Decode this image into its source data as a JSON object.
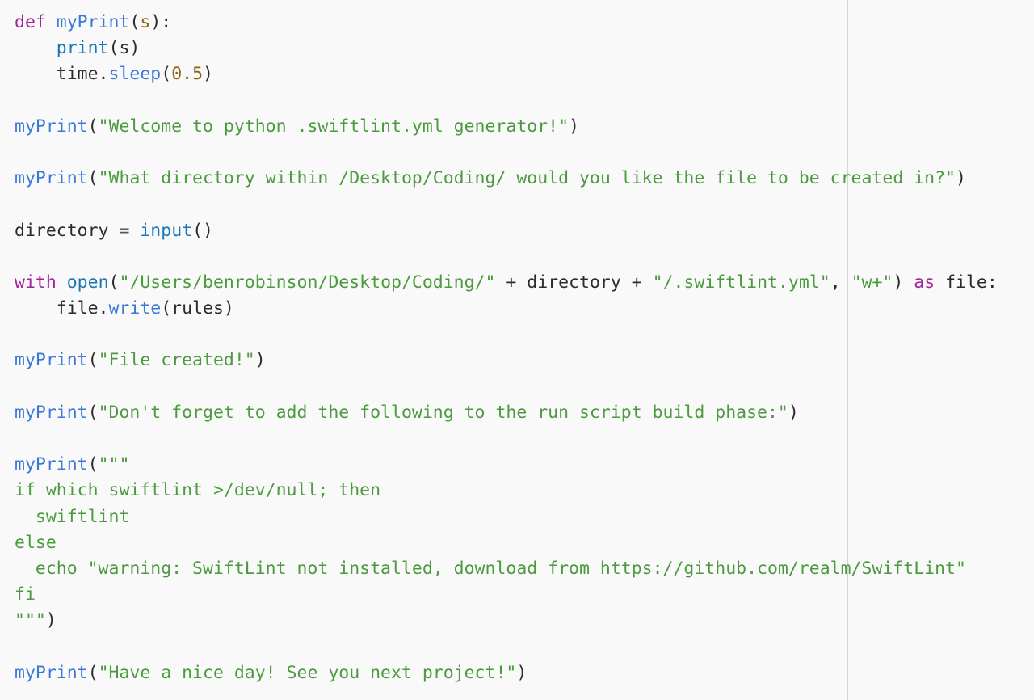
{
  "colors": {
    "background": "#f9f9f9",
    "keyword": "#a3239d",
    "function": "#3c78d8",
    "builtin": "#1a76b8",
    "string": "#4c9a3f",
    "number": "#8b6508",
    "text": "#2b2b2b"
  },
  "code": {
    "lines": [
      [
        {
          "t": "kw",
          "v": "def"
        },
        {
          "t": "txt",
          "v": " "
        },
        {
          "t": "fn",
          "v": "myPrint"
        },
        {
          "t": "txt",
          "v": "("
        },
        {
          "t": "prm",
          "v": "s"
        },
        {
          "t": "txt",
          "v": "):"
        }
      ],
      [
        {
          "t": "txt",
          "v": "    "
        },
        {
          "t": "bi",
          "v": "print"
        },
        {
          "t": "txt",
          "v": "(s)"
        }
      ],
      [
        {
          "t": "txt",
          "v": "    time."
        },
        {
          "t": "fn",
          "v": "sleep"
        },
        {
          "t": "txt",
          "v": "("
        },
        {
          "t": "num",
          "v": "0.5"
        },
        {
          "t": "txt",
          "v": ")"
        }
      ],
      [],
      [
        {
          "t": "fn",
          "v": "myPrint"
        },
        {
          "t": "txt",
          "v": "("
        },
        {
          "t": "str",
          "v": "\"Welcome to python .swiftlint.yml generator!\""
        },
        {
          "t": "txt",
          "v": ")"
        }
      ],
      [],
      [
        {
          "t": "fn",
          "v": "myPrint"
        },
        {
          "t": "txt",
          "v": "("
        },
        {
          "t": "str",
          "v": "\"What directory within /Desktop/Coding/ would you like the file to be created in?\""
        },
        {
          "t": "txt",
          "v": ")"
        }
      ],
      [],
      [
        {
          "t": "txt",
          "v": "directory "
        },
        {
          "t": "op",
          "v": "="
        },
        {
          "t": "txt",
          "v": " "
        },
        {
          "t": "bi",
          "v": "input"
        },
        {
          "t": "txt",
          "v": "()"
        }
      ],
      [],
      [
        {
          "t": "kw",
          "v": "with"
        },
        {
          "t": "txt",
          "v": " "
        },
        {
          "t": "bi",
          "v": "open"
        },
        {
          "t": "txt",
          "v": "("
        },
        {
          "t": "str",
          "v": "\"/Users/benrobinson/Desktop/Coding/\""
        },
        {
          "t": "txt",
          "v": " + directory + "
        },
        {
          "t": "str",
          "v": "\"/.swiftlint.yml\""
        },
        {
          "t": "txt",
          "v": ", "
        },
        {
          "t": "str",
          "v": "\"w+\""
        },
        {
          "t": "txt",
          "v": ") "
        },
        {
          "t": "kw",
          "v": "as"
        },
        {
          "t": "txt",
          "v": " file:"
        }
      ],
      [
        {
          "t": "txt",
          "v": "    file."
        },
        {
          "t": "fn",
          "v": "write"
        },
        {
          "t": "txt",
          "v": "(rules)"
        }
      ],
      [],
      [
        {
          "t": "fn",
          "v": "myPrint"
        },
        {
          "t": "txt",
          "v": "("
        },
        {
          "t": "str",
          "v": "\"File created!\""
        },
        {
          "t": "txt",
          "v": ")"
        }
      ],
      [],
      [
        {
          "t": "fn",
          "v": "myPrint"
        },
        {
          "t": "txt",
          "v": "("
        },
        {
          "t": "str",
          "v": "\"Don't forget to add the following to the run script build phase:\""
        },
        {
          "t": "txt",
          "v": ")"
        }
      ],
      [],
      [
        {
          "t": "fn",
          "v": "myPrint"
        },
        {
          "t": "txt",
          "v": "("
        },
        {
          "t": "str",
          "v": "\"\"\""
        }
      ],
      [
        {
          "t": "str",
          "v": "if which swiftlint >/dev/null; then"
        }
      ],
      [
        {
          "t": "str",
          "v": "  swiftlint"
        }
      ],
      [
        {
          "t": "str",
          "v": "else"
        }
      ],
      [
        {
          "t": "str",
          "v": "  echo \"warning: SwiftLint not installed, download from https://github.com/realm/SwiftLint\""
        }
      ],
      [
        {
          "t": "str",
          "v": "fi"
        }
      ],
      [
        {
          "t": "str",
          "v": "\"\"\""
        },
        {
          "t": "txt",
          "v": ")"
        }
      ],
      [],
      [
        {
          "t": "fn",
          "v": "myPrint"
        },
        {
          "t": "txt",
          "v": "("
        },
        {
          "t": "str",
          "v": "\"Have a nice day! See you next project!\""
        },
        {
          "t": "txt",
          "v": ")"
        }
      ]
    ]
  }
}
